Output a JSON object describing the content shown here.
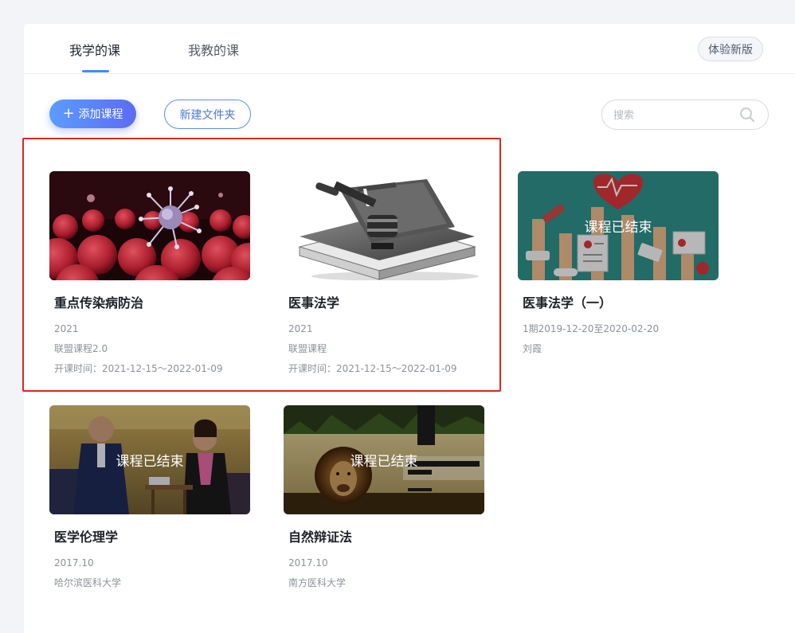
{
  "tabs": [
    {
      "label": "我学的课",
      "active": true
    },
    {
      "label": "我教的课",
      "active": false
    }
  ],
  "try_new_label": "体验新版",
  "toolbar": {
    "add_label": "添加课程",
    "add_icon": "plus-icon",
    "folder_label": "新建文件夹",
    "search_placeholder": "搜索",
    "search_icon": "search-icon"
  },
  "colors": {
    "accent": "#3a8ef6",
    "highlight": "#e0251c"
  },
  "courses": [
    {
      "title": "重点传染病防治",
      "lines": [
        "2021",
        "联盟课程2.0",
        "开课时间：2021-12-15～2022-01-09"
      ],
      "ended": false,
      "ended_label": ""
    },
    {
      "title": "医事法学",
      "lines": [
        "2021",
        "联盟课程",
        "开课时间：2021-12-15～2022-01-09"
      ],
      "ended": false,
      "ended_label": ""
    },
    {
      "title": "医事法学（一）",
      "lines": [
        "1期2019-12-20至2020-02-20",
        "刘霞"
      ],
      "ended": true,
      "ended_label": "课程已结束"
    },
    {
      "title": "医学伦理学",
      "lines": [
        "2017.10",
        "哈尔滨医科大学"
      ],
      "ended": true,
      "ended_label": "课程已结束"
    },
    {
      "title": "自然辩证法",
      "lines": [
        "2017.10",
        "南方医科大学"
      ],
      "ended": true,
      "ended_label": "课程已结束"
    }
  ]
}
